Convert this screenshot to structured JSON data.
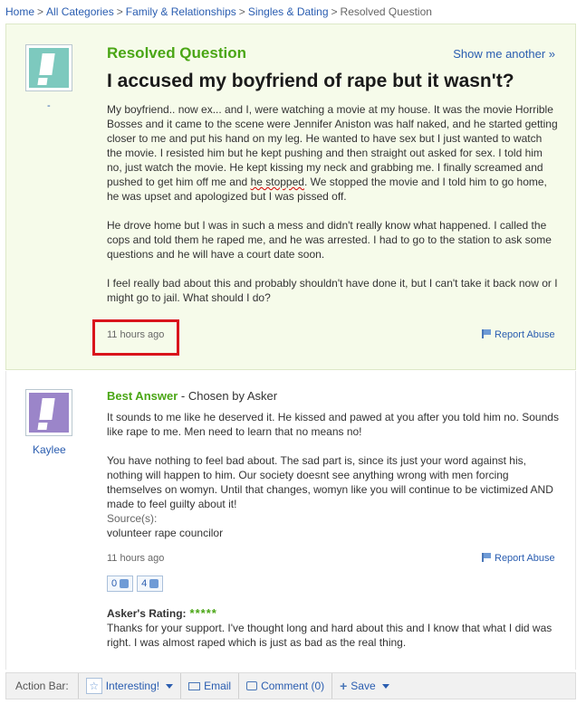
{
  "breadcrumb": {
    "items": [
      "Home",
      "All Categories",
      "Family & Relationships",
      "Singles & Dating"
    ],
    "current": "Resolved Question",
    "separator": ">"
  },
  "question": {
    "label": "Resolved Question",
    "show_another": "Show me another »",
    "avatar_name": "-",
    "title": "I accused my boyfriend of rape but it wasn't?",
    "body_p1_a": "My boyfriend.. now ex... and I, were watching a movie at my house. It was the movie Horrible Bosses and it came to the scene were Jennifer Aniston was half naked, and he started getting closer to me and put his hand on my leg. He wanted to have sex but I just wanted to watch the movie. I resisted him but he kept pushing and then straight out asked for sex. I told him no, just watch the movie. He kept kissing my neck and grabbing me. I finally screamed and pushed to get him off me and ",
    "body_p1_squiggle": "he stopped",
    "body_p1_b": ". We stopped the movie and I told him to go home, he was upset and apologized but I was pissed off.",
    "body_p2": "He drove home but I was in such a mess and didn't really know what happened. I called the cops and told them he raped me, and he was arrested. I had to go to the station to ask some questions and he will have a court date soon.",
    "body_p3": "I feel really bad about this and probably shouldn't have done it, but I can't take it back now or I might go to jail. What should I do?",
    "time": "11 hours ago",
    "report": "Report Abuse"
  },
  "answer": {
    "avatar_name": "Kaylee",
    "label": "Best Answer",
    "chosen": " - Chosen by Asker",
    "body_p1": "It sounds to me like he deserved it. He kissed and pawed at you after you told him no. Sounds like rape to me. Men need to learn that no means no!",
    "body_p2": "You have nothing to feel bad about. The sad part is, since its just your word against his, nothing will happen to him. Our society doesnt see anything wrong with men forcing themselves on womyn. Until that changes, womyn like you will continue to be victimized AND made to feel guilty about it!",
    "source_label": "Source(s):",
    "source": "volunteer rape councilor",
    "time": "11 hours ago",
    "report": "Report Abuse",
    "thumbs_up": "0",
    "thumbs_down": "4",
    "rating_label": "Asker's Rating:",
    "rating_stars": "*****",
    "rating_value": 5,
    "rating_comment": "Thanks for your support. I've thought long and hard about this and I know that what I did was right. I was almost raped which is just as bad as the real thing."
  },
  "action_bar": {
    "label": "Action Bar:",
    "interesting": "Interesting!",
    "email": "Email",
    "comment": "Comment (0)",
    "save": "Save"
  },
  "colors": {
    "green_accent": "#4aa615",
    "link_blue": "#2a5db0",
    "highlight_red": "#d9141c",
    "question_bg": "#f6fbea"
  }
}
